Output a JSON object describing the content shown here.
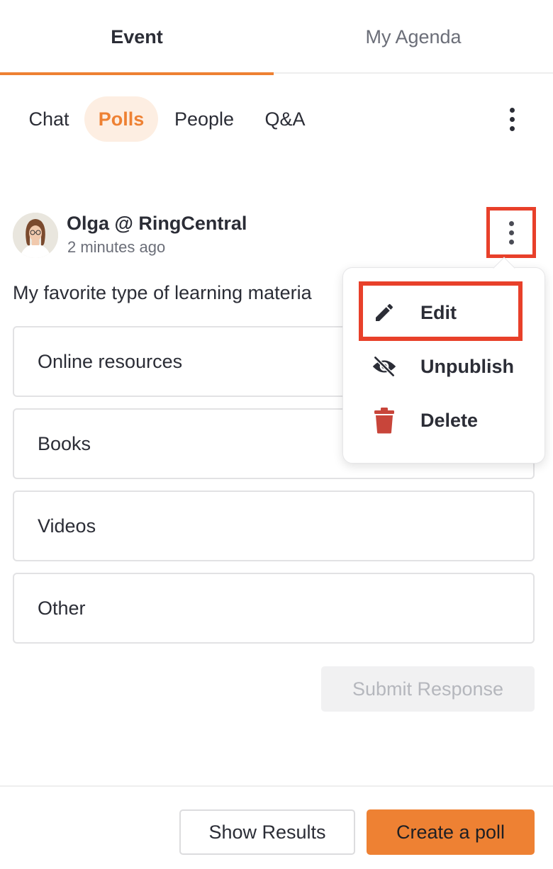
{
  "tabs": [
    {
      "label": "Event",
      "active": true
    },
    {
      "label": "My Agenda",
      "active": false
    }
  ],
  "subtabs": [
    {
      "label": "Chat",
      "active": false
    },
    {
      "label": "Polls",
      "active": true
    },
    {
      "label": "People",
      "active": false
    },
    {
      "label": "Q&A",
      "active": false
    }
  ],
  "poll": {
    "author": "Olga @ RingCentral",
    "time": "2 minutes ago",
    "question": "My favorite type of learning materia",
    "options": [
      "Online resources",
      "Books",
      "Videos",
      "Other"
    ],
    "submit_label": "Submit Response"
  },
  "menu": {
    "items": [
      {
        "label": "Edit",
        "icon": "pencil-icon"
      },
      {
        "label": "Unpublish",
        "icon": "eye-slash-icon"
      },
      {
        "label": "Delete",
        "icon": "trash-icon"
      }
    ]
  },
  "footer": {
    "show_results_label": "Show Results",
    "create_poll_label": "Create a poll"
  },
  "colors": {
    "accent": "#ee8133",
    "accent_light": "#fdeee2",
    "highlight": "#e8402a",
    "delete": "#c8453a"
  }
}
